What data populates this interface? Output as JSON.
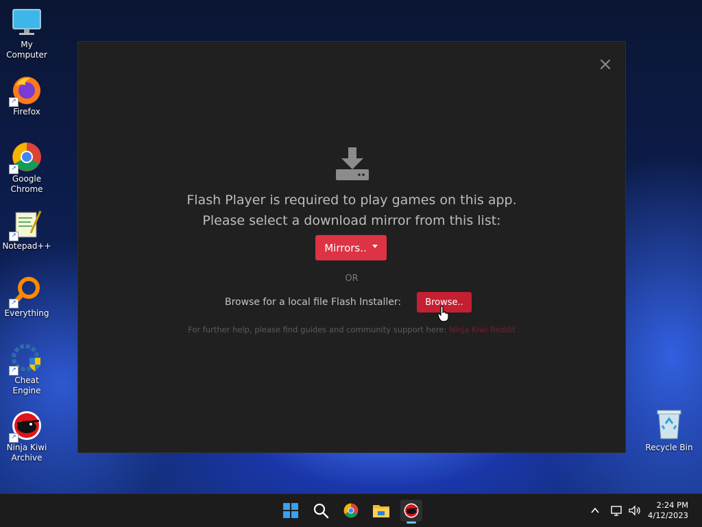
{
  "desktop": {
    "icons": [
      {
        "label": "My Computer",
        "icon": "monitor-icon"
      },
      {
        "label": "Firefox",
        "icon": "firefox-icon"
      },
      {
        "label": "Google Chrome",
        "icon": "chrome-icon"
      },
      {
        "label": "Notepad++",
        "icon": "notepadpp-icon"
      },
      {
        "label": "Everything",
        "icon": "search-magnifier-icon"
      },
      {
        "label": "Cheat Engine",
        "icon": "cheat-engine-icon"
      },
      {
        "label": "Ninja Kiwi Archive",
        "icon": "ninja-kiwi-icon"
      }
    ],
    "recycle_bin": {
      "label": "Recycle Bin",
      "icon": "recycle-bin-icon"
    }
  },
  "dialog": {
    "close_label": "×",
    "message_line1": "Flash Player is required to play games on this app.",
    "message_line2": "Please select a download mirror from this list:",
    "mirrors_button": "Mirrors..",
    "or_label": "OR",
    "browse_label": "Browse for a local file Flash Installer:",
    "browse_button": "Browse..",
    "help_text": "For further help, please find guides and community support here:",
    "help_link_1": "Ninja Kiwi",
    "help_link_2": "Reddit",
    "accent_color": "#dd3344"
  },
  "taskbar": {
    "apps": [
      {
        "name": "Start",
        "icon": "windows-start-icon"
      },
      {
        "name": "Search",
        "icon": "search-icon"
      },
      {
        "name": "Google Chrome",
        "icon": "chrome-icon"
      },
      {
        "name": "File Explorer",
        "icon": "folder-icon"
      },
      {
        "name": "Ninja Kiwi Archive",
        "icon": "ninja-kiwi-icon",
        "active": true
      }
    ],
    "clock": {
      "time": "2:24 PM",
      "date": "4/12/2023"
    }
  }
}
